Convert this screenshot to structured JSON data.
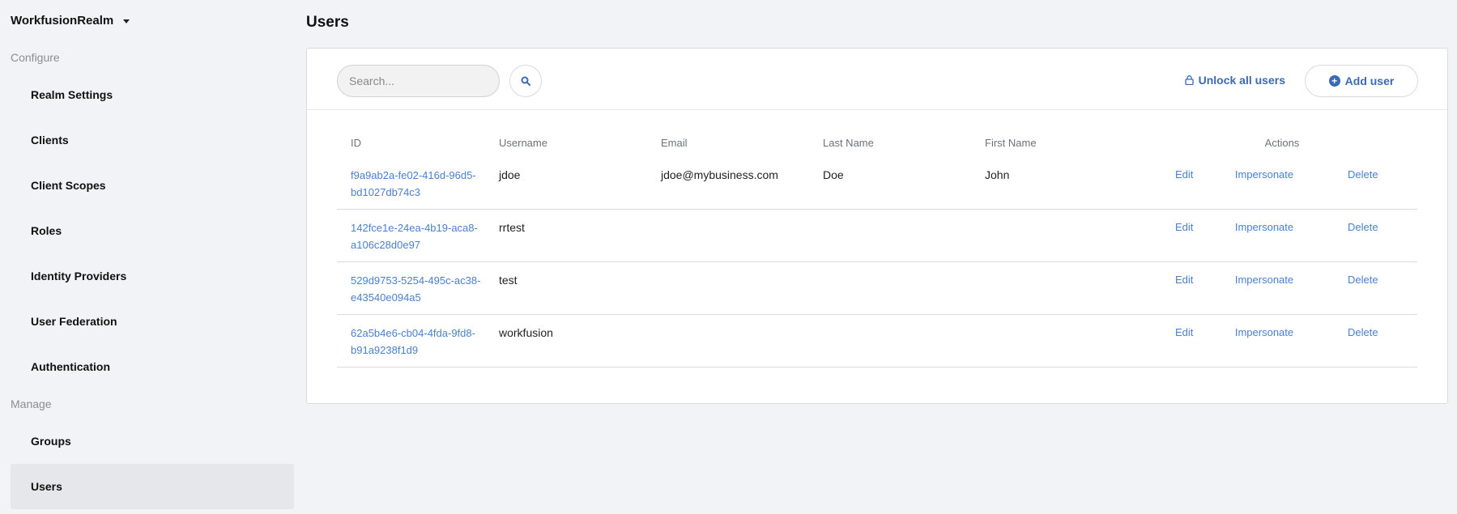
{
  "sidebar": {
    "realm": "WorkfusionRealm",
    "configure_label": "Configure",
    "configure_items": [
      {
        "label": "Realm Settings"
      },
      {
        "label": "Clients"
      },
      {
        "label": "Client Scopes"
      },
      {
        "label": "Roles"
      },
      {
        "label": "Identity Providers"
      },
      {
        "label": "User Federation"
      },
      {
        "label": "Authentication"
      }
    ],
    "manage_label": "Manage",
    "manage_items": [
      {
        "label": "Groups"
      },
      {
        "label": "Users",
        "active": true
      }
    ]
  },
  "page": {
    "title": "Users"
  },
  "toolbar": {
    "search_placeholder": "Search...",
    "unlock_label": "Unlock all users",
    "add_label": "Add user"
  },
  "table": {
    "headers": {
      "id": "ID",
      "username": "Username",
      "email": "Email",
      "last_name": "Last Name",
      "first_name": "First Name",
      "actions": "Actions"
    },
    "action_labels": {
      "edit": "Edit",
      "impersonate": "Impersonate",
      "delete": "Delete"
    },
    "rows": [
      {
        "id": "f9a9ab2a-fe02-416d-96d5-bd1027db74c3",
        "username": "jdoe",
        "email": "jdoe@mybusiness.com",
        "last_name": "Doe",
        "first_name": "John"
      },
      {
        "id": "142fce1e-24ea-4b19-aca8-a106c28d0e97",
        "username": "rrtest",
        "email": "",
        "last_name": "",
        "first_name": ""
      },
      {
        "id": "529d9753-5254-495c-ac38-e43540e094a5",
        "username": "test",
        "email": "",
        "last_name": "",
        "first_name": ""
      },
      {
        "id": "62a5b4e6-cb04-4fda-9fd8-b91a9238f1d9",
        "username": "workfusion",
        "email": "",
        "last_name": "",
        "first_name": ""
      }
    ]
  },
  "colors": {
    "accent": "#3b6ab5",
    "link": "#4a80d0",
    "background": "#f2f3f7"
  }
}
